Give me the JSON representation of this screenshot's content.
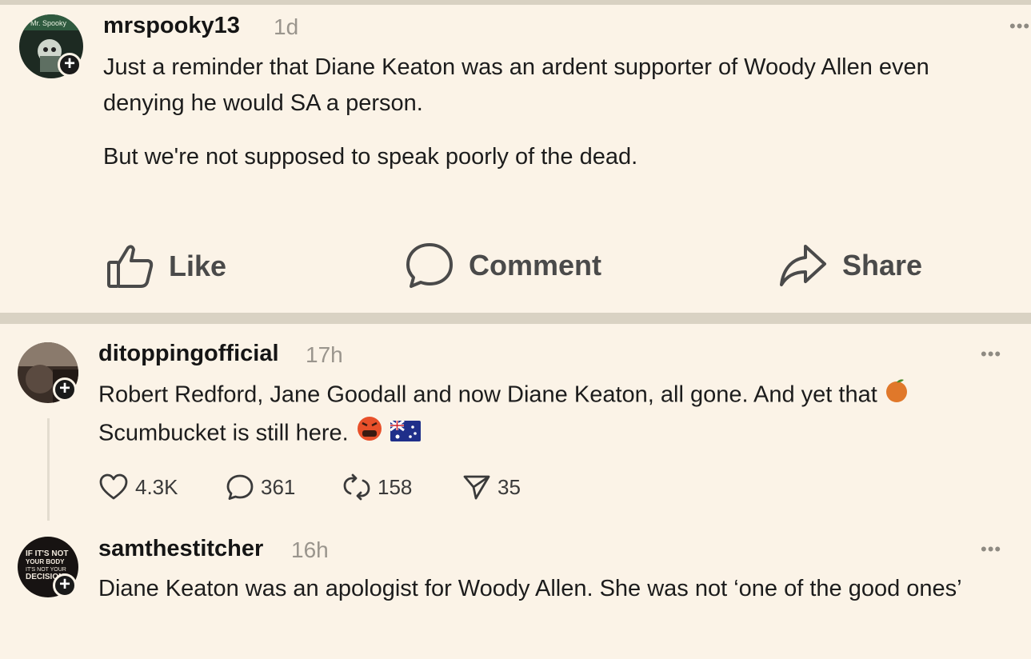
{
  "post": {
    "username": "mrspooky13",
    "time": "1d",
    "avatar_text": "Mr. Spooky",
    "paragraph1": "Just a reminder that Diane Keaton was an ardent supporter of Woody Allen even denying he would SA a person.",
    "paragraph2": "But we're not supposed to speak poorly of the dead.",
    "actions": {
      "like": "Like",
      "comment": "Comment",
      "share": "Share"
    }
  },
  "replies": [
    {
      "username": "ditoppingofficial",
      "time": "17h",
      "text_main": "Robert Redford, Jane Goodall and now Diane Keaton, all gone. And yet that",
      "text_tail": "Scumbucket is still here.",
      "emojis": [
        "orange-emoji",
        "angry-face-emoji",
        "australia-flag-emoji"
      ],
      "stats": {
        "likes": "4.3K",
        "comments": "361",
        "reposts": "158",
        "shares": "35"
      }
    },
    {
      "username": "samthestitcher",
      "time": "16h",
      "avatar_text": "IF IT'S NOT YOUR BODY IT'S NOT YOUR DECISION",
      "text": "Diane Keaton was an apologist for Woody Allen. She was not ‘one of the good ones’"
    }
  ],
  "icons": [
    "more-icon",
    "like-icon",
    "comment-icon",
    "share-icon",
    "heart-icon",
    "reply-icon",
    "repost-icon",
    "send-icon",
    "follow-plus-icon"
  ],
  "colors": {
    "background": "#fbf3e7",
    "divider": "#d9d2c3",
    "muted": "#9a958d"
  }
}
